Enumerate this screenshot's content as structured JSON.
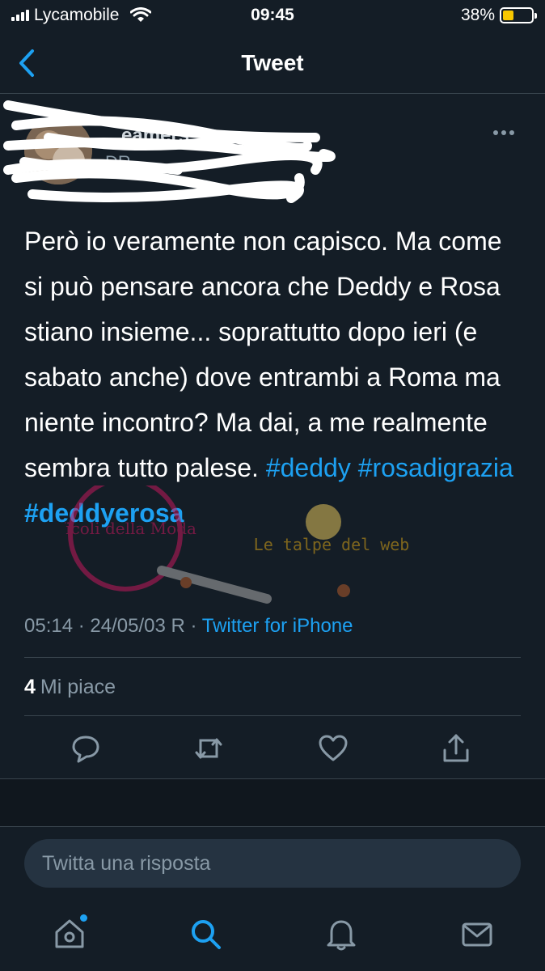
{
  "status_bar": {
    "carrier": "Lycamobile",
    "time": "09:45",
    "battery_percent": "38%",
    "battery_level": 0.38,
    "battery_color": "#f7c700"
  },
  "navbar": {
    "title": "Tweet",
    "back_icon": "chevron-left-icon"
  },
  "tweet": {
    "author_name": "...eamers",
    "author_handle": "DR",
    "text_plain": "Però io veramente non capisco. Ma come si può pensare ancora che Deddy e Rosa stiano insieme... soprattutto dopo ieri (e sabato anche) dove entrambi a Roma ma niente incontro? Ma dai, a me realmente sembra tutto palese.",
    "hashtags": [
      "#deddy",
      "#rosadigrazia",
      "#deddyerosa"
    ],
    "time": "05:14",
    "separator": "·",
    "date": "24/05/03 R",
    "source": "Twitter for iPhone",
    "likes_count": "4",
    "likes_label": "Mi piace"
  },
  "actions": [
    {
      "name": "reply",
      "icon": "comment-icon"
    },
    {
      "name": "retweet",
      "icon": "retweet-icon"
    },
    {
      "name": "like",
      "icon": "heart-icon"
    },
    {
      "name": "share",
      "icon": "share-icon"
    }
  ],
  "reply_box": {
    "placeholder": "Twitta una risposta"
  },
  "tabbar": [
    {
      "name": "home",
      "icon": "home-icon",
      "has_notification_dot": true
    },
    {
      "name": "search",
      "icon": "search-icon",
      "active": true
    },
    {
      "name": "notifications",
      "icon": "bell-icon"
    },
    {
      "name": "messages",
      "icon": "mail-icon"
    }
  ],
  "watermark": {
    "text_1": "Vicoli della Moda",
    "text_2": "Le talpe del web"
  },
  "colors": {
    "background": "#141d26",
    "accent": "#1da1f2",
    "secondary_text": "#8899a6",
    "divider": "#38444d"
  }
}
